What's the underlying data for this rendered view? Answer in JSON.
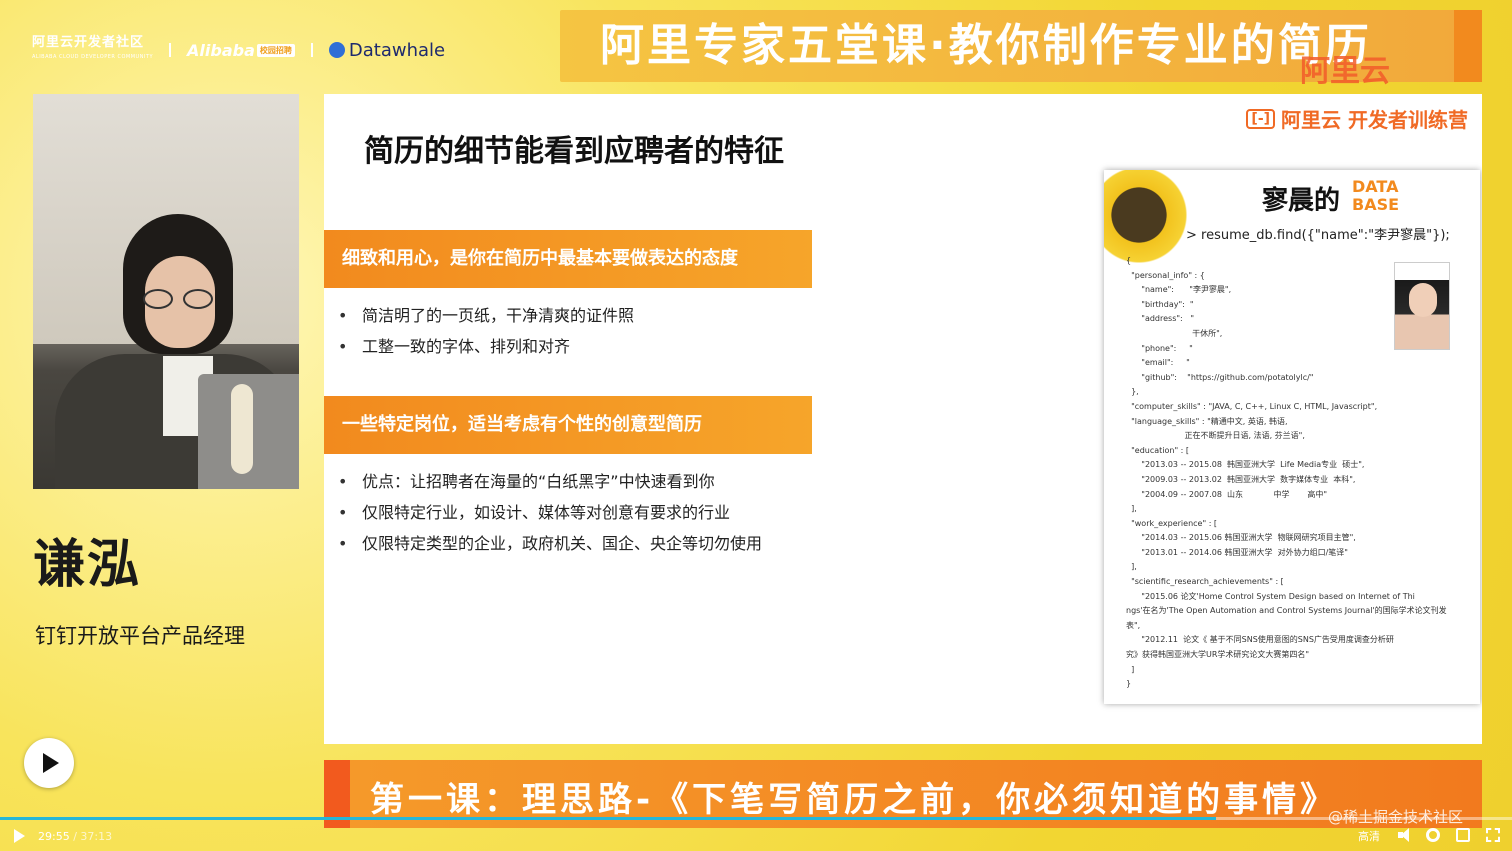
{
  "header": {
    "logo_aliyun": "阿里云开发者社区",
    "logo_aliyun_sub": "ALIBABA CLOUD DEVELOPER COMMUNITY",
    "logo_alibaba": "Alibaba",
    "logo_alibaba_tag": "校园招聘",
    "logo_datawhale": "Datawhale",
    "title": "阿里专家五堂课·教你制作专业的简历",
    "watermark": "阿里云"
  },
  "speaker": {
    "name": "谦泓",
    "role": "钉钉开放平台产品经理"
  },
  "slide": {
    "brand": "阿里云 开发者训练营",
    "brand_mark": "[-]",
    "title": "简历的细节能看到应聘者的特征",
    "section1": {
      "heading": "细致和用心，是你在简历中最基本要做表达的态度",
      "bullets": [
        "简洁明了的一页纸，干净清爽的证件照",
        "工整一致的字体、排列和对齐"
      ]
    },
    "section2": {
      "heading": "一些特定岗位，适当考虑有个性的创意型简历",
      "bullets": [
        "优点：让招聘者在海量的“白纸黑字”中快速看到你",
        "仅限特定行业，如设计、媒体等对创意有要求的行业",
        "仅限特定类型的企业，政府机关、国企、央企等切勿使用"
      ]
    },
    "resume": {
      "title": "寥晨的",
      "db_line1": "DATA",
      "db_line2": "BASE",
      "command": "> resume_db.find({\"name\":\"李尹寥晨\"});",
      "lines": [
        "{",
        "  \"personal_info\" : {",
        "      \"name\":      \"李尹寥晨\",",
        "      \"birthday\":  \"",
        "      \"address\":   \"",
        "                          干休所\",",
        "      \"phone\":     \"",
        "      \"email\":     \"",
        "      \"github\":    \"https://github.com/potatolylc/\"",
        "  },",
        "  \"computer_skills\" : \"JAVA, C, C++, Linux C, HTML, Javascript\",",
        "  \"language_skills\" : \"精通中文, 英语, 韩语,",
        "                       正在不断提升日语, 法语, 芬兰语\",",
        "  \"education\" : [",
        "      \"2013.03 -- 2015.08  韩国亚洲大学  Life Media专业  硕士\",",
        "      \"2009.03 -- 2013.02  韩国亚洲大学  数字媒体专业  本科\",",
        "      \"2004.09 -- 2007.08  山东            中学       高中\"",
        "  ],",
        "  \"work_experience\" : [",
        "      \"2014.03 -- 2015.06 韩国亚洲大学  物联网研究项目主管\",",
        "      \"2013.01 -- 2014.06 韩国亚洲大学  对外协力组口/笔译\"",
        "  ],",
        "  \"scientific_research_achievements\" : [",
        "      \"2015.06 论文'Home Control System Design based on Internet of Thi",
        "ngs'在名为'The Open Automation and Control Systems Journal'的国际学术论文刊发",
        "表\",",
        "      \"2012.11  论文《 基于不同SNS使用意图的SNS广告受用度调查分析研",
        "究》获得韩国亚洲大学UR学术研究论文大赛第四名\"",
        "  ]",
        "}"
      ]
    }
  },
  "bottom_banner": "第一课：理思路-《下笔写简历之前，你必须知道的事情》",
  "player": {
    "current_time": "29:55",
    "total_time": "37:13",
    "progress": 0.804,
    "quality": "高清",
    "watermark": "@稀土掘金技术社区"
  },
  "colors": {
    "accent_orange": "#f28a1e",
    "background_yellow": "#f6e24a",
    "progress_blue": "#26b7d8"
  }
}
